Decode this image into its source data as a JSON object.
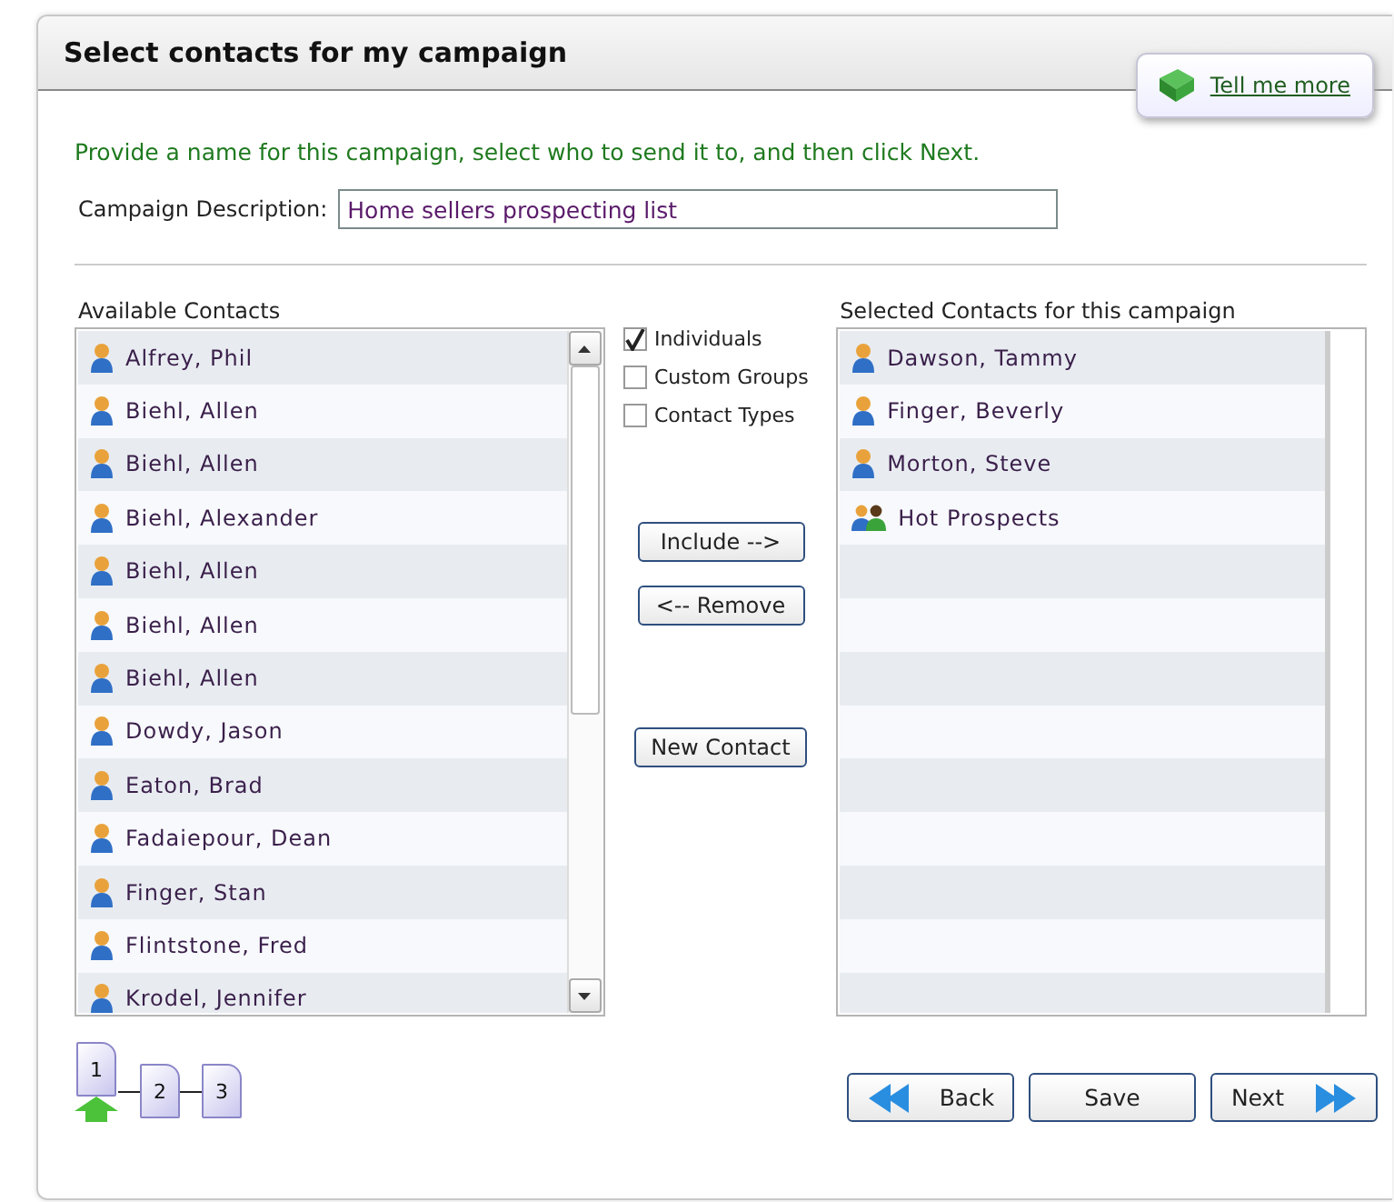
{
  "title": "Select contacts for my campaign",
  "help_link": "Tell me more",
  "instructions": "Provide a name for this campaign, select who to send it to, and then click Next.",
  "campaign_description": {
    "label": "Campaign Description:",
    "value": "Home sellers prospecting list"
  },
  "available": {
    "label": "Available Contacts",
    "items": [
      {
        "name": "Alfrey, Phil",
        "kind": "person"
      },
      {
        "name": "Biehl, Allen",
        "kind": "person"
      },
      {
        "name": "Biehl, Allen",
        "kind": "person"
      },
      {
        "name": "Biehl, Alexander",
        "kind": "person"
      },
      {
        "name": "Biehl, Allen",
        "kind": "person"
      },
      {
        "name": "Biehl, Allen",
        "kind": "person"
      },
      {
        "name": "Biehl, Allen",
        "kind": "person"
      },
      {
        "name": "Dowdy, Jason",
        "kind": "person"
      },
      {
        "name": "Eaton, Brad",
        "kind": "person"
      },
      {
        "name": "Fadaiepour, Dean",
        "kind": "person"
      },
      {
        "name": "Finger, Stan",
        "kind": "person"
      },
      {
        "name": "Flintstone, Fred",
        "kind": "person"
      },
      {
        "name": "Krodel, Jennifer",
        "kind": "person"
      }
    ]
  },
  "filters": [
    {
      "label": "Individuals",
      "checked": true
    },
    {
      "label": "Custom Groups",
      "checked": false
    },
    {
      "label": "Contact Types",
      "checked": false
    }
  ],
  "middle_buttons": [
    "Include -->",
    "<-- Remove",
    "New Contact"
  ],
  "selected": {
    "label": "Selected Contacts for this campaign",
    "items": [
      {
        "name": "Dawson, Tammy",
        "kind": "person"
      },
      {
        "name": "Finger, Beverly",
        "kind": "person"
      },
      {
        "name": "Morton, Steve",
        "kind": "person"
      },
      {
        "name": "Hot Prospects",
        "kind": "group"
      }
    ]
  },
  "steps": [
    {
      "label": "1",
      "selected": true
    },
    {
      "label": "2",
      "selected": false
    },
    {
      "label": "3",
      "selected": false
    }
  ],
  "nav_buttons": [
    {
      "label": "Back",
      "kind": "back"
    },
    {
      "label": "Save",
      "kind": "plain"
    },
    {
      "label": "Next",
      "kind": "next"
    }
  ]
}
